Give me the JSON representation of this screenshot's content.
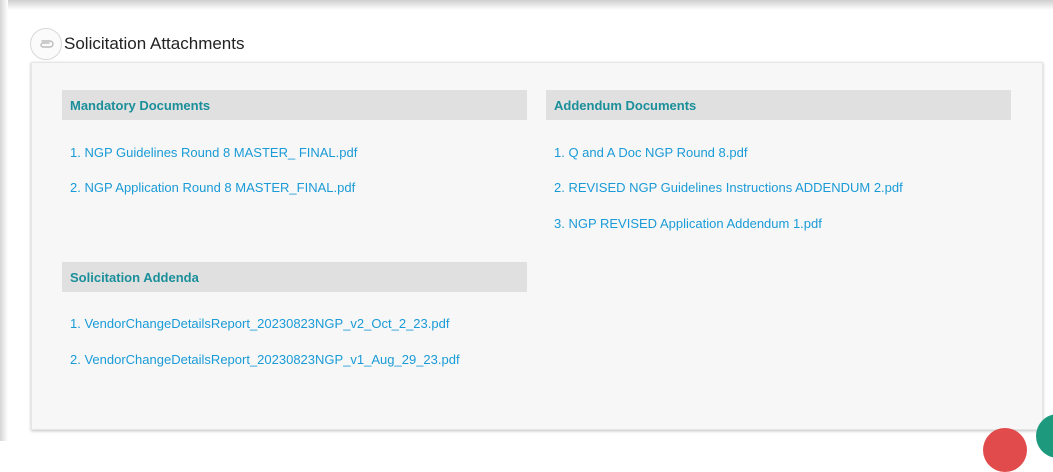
{
  "header": {
    "title": "Solicitation Attachments",
    "icon": "paperclip-icon"
  },
  "sections": {
    "mandatory": {
      "title": "Mandatory Documents",
      "items": [
        "1. NGP Guidelines Round 8 MASTER_ FINAL.pdf",
        "2. NGP Application Round 8 MASTER_FINAL.pdf"
      ]
    },
    "addendum": {
      "title": "Addendum Documents",
      "items": [
        "1. Q and A Doc NGP Round 8.pdf",
        "2. REVISED NGP Guidelines Instructions ADDENDUM 2.pdf",
        "3. NGP REVISED Application Addendum 1.pdf"
      ]
    },
    "solicitation_addenda": {
      "title": "Solicitation Addenda",
      "items": [
        "1. VendorChangeDetailsReport_20230823NGP_v2_Oct_2_23.pdf",
        "2. VendorChangeDetailsReport_20230823NGP_v1_Aug_29_23.pdf"
      ]
    }
  },
  "colors": {
    "section_title": "#1a8f9a",
    "link": "#1a9bd7",
    "section_bg": "#e0e0e0",
    "panel_bg": "#f7f7f7"
  }
}
